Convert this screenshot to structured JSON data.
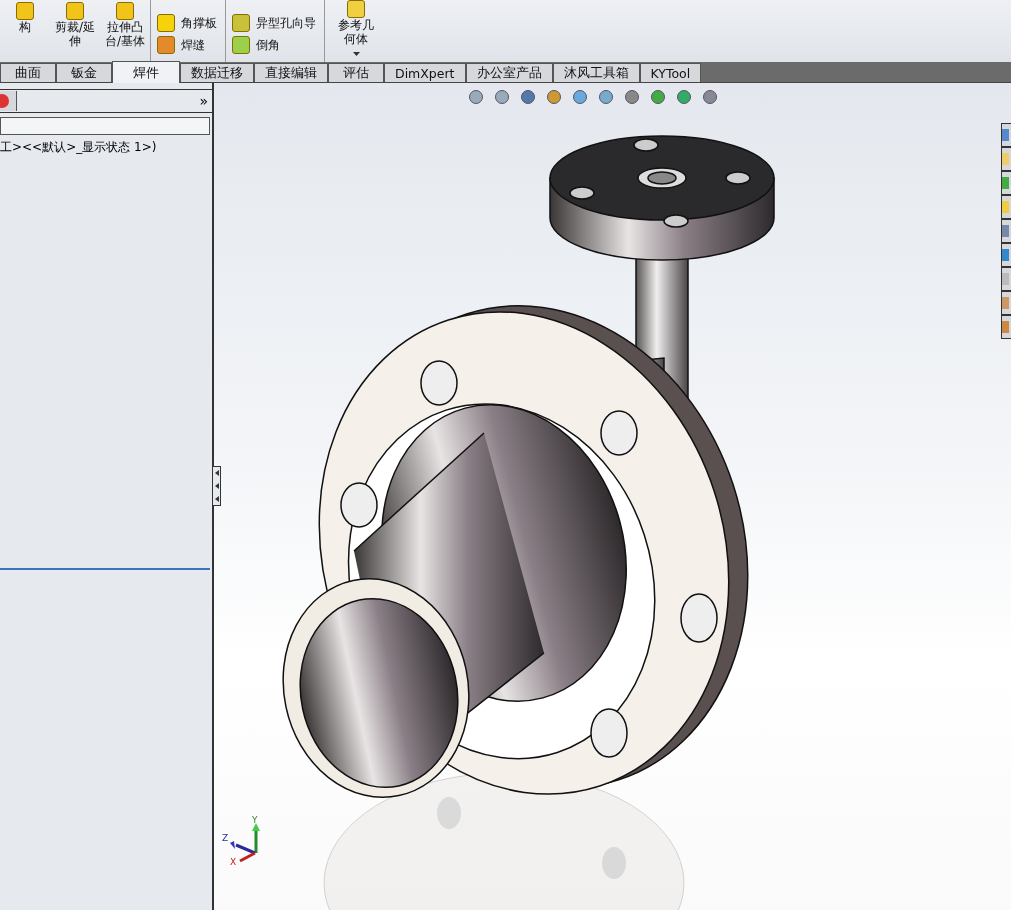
{
  "ribbon": {
    "large_buttons": [
      {
        "label": "构"
      },
      {
        "label": "剪裁/延伸"
      },
      {
        "label": "拉伸凸台/基体"
      }
    ],
    "columns": [
      {
        "items": [
          {
            "label": "角撑板",
            "kind": "gusset"
          },
          {
            "label": "焊缝",
            "kind": "weld"
          }
        ]
      },
      {
        "items": [
          {
            "label": "异型孔向导",
            "kind": "hole"
          },
          {
            "label": "倒角",
            "kind": "chamfer"
          }
        ]
      }
    ],
    "reference": {
      "label": "参考几何体"
    }
  },
  "tabs": [
    {
      "label": "曲面",
      "selected": false
    },
    {
      "label": "钣金",
      "selected": false
    },
    {
      "label": "焊件",
      "selected": true
    },
    {
      "label": "数据迁移",
      "selected": false
    },
    {
      "label": "直接编辑",
      "selected": false
    },
    {
      "label": "评估",
      "selected": false
    },
    {
      "label": "DimXpert",
      "selected": false
    },
    {
      "label": "办公室产品",
      "selected": false
    },
    {
      "label": "沐风工具箱",
      "selected": false
    },
    {
      "label": "KYTool",
      "selected": false
    }
  ],
  "feature_manager": {
    "expand_glyph": "»",
    "tree_text": "工><<默认>_显示状态 1>)"
  },
  "triad": {
    "y": "Y",
    "z": "Z",
    "x": "X"
  }
}
